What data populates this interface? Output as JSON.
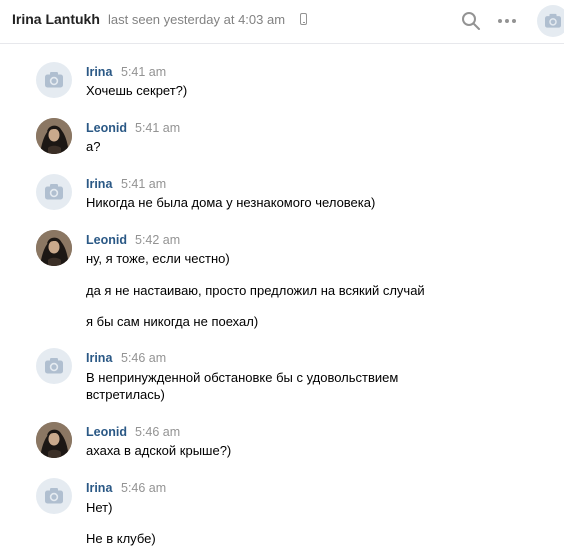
{
  "header": {
    "contact_name": "Irina Lantukh",
    "status": "last seen yesterday at 4:03 am",
    "icons": [
      "phone-icon",
      "search-icon",
      "more-icon",
      "camera-avatar-icon"
    ]
  },
  "colors": {
    "author": "#2a5885",
    "time": "#939393",
    "avatar_bg": "#e5ebf1",
    "camera_icon": "#b0bfd0"
  },
  "messages": [
    {
      "author": "Irina",
      "time": "5:41 am",
      "avatar": "camera-avatar-icon",
      "lines": [
        "Хочешь секрет?)"
      ]
    },
    {
      "author": "Leonid",
      "time": "5:41 am",
      "avatar": "user-photo",
      "lines": [
        "а?"
      ]
    },
    {
      "author": "Irina",
      "time": "5:41 am",
      "avatar": "camera-avatar-icon",
      "lines": [
        "Никогда не была дома у незнакомого человека)"
      ]
    },
    {
      "author": "Leonid",
      "time": "5:42 am",
      "avatar": "user-photo",
      "lines": [
        "ну, я тоже, если честно)",
        "да я не настаиваю, просто предложил на всякий случай",
        "я бы сам никогда не поехал)"
      ]
    },
    {
      "author": "Irina",
      "time": "5:46 am",
      "avatar": "camera-avatar-icon",
      "lines": [
        "В непринужденной обстановке бы с удовольствием",
        "встретилась)"
      ]
    },
    {
      "author": "Leonid",
      "time": "5:46 am",
      "avatar": "user-photo",
      "lines": [
        "ахаха в адской крыше?)"
      ]
    },
    {
      "author": "Irina",
      "time": "5:46 am",
      "avatar": "camera-avatar-icon",
      "lines": [
        "Нет)",
        "Не в клубе)"
      ]
    }
  ]
}
